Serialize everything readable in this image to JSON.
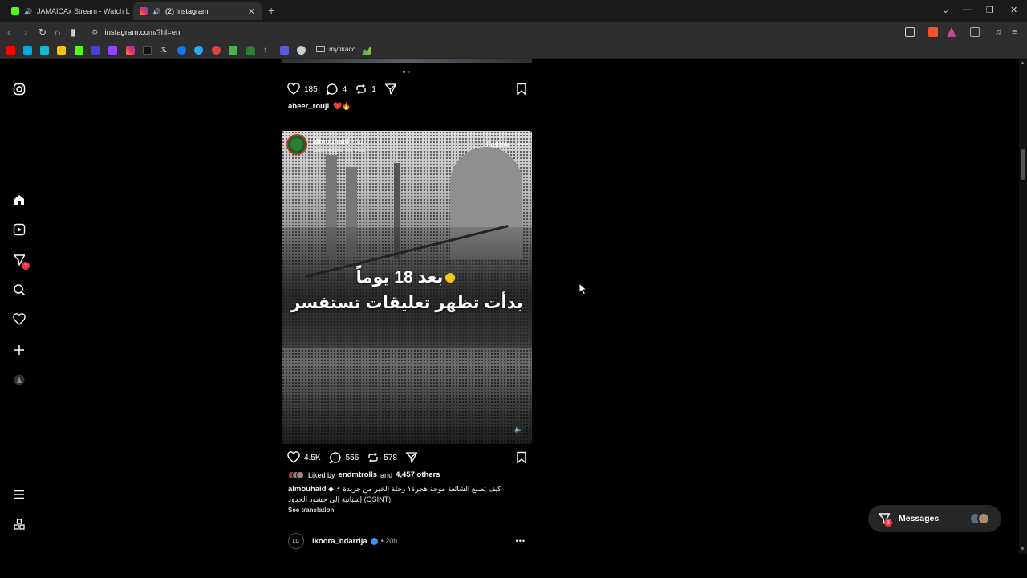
{
  "browser": {
    "tabs": [
      {
        "title": "JAMAICAx Stream - Watch Live o",
        "favicon_color": "#53fc18",
        "active": false
      },
      {
        "title": "(2) Instagram",
        "favicon_color": "#e1306c",
        "active": true
      }
    ],
    "new_tab": "+",
    "url": "instagram.com/?hl=en",
    "bookmark_folder": "mytikacc",
    "bookmark_icons": [
      "youtube",
      "prime-video",
      "perplexity",
      "kick",
      "nord",
      "twitch",
      "instagram",
      "tiktok",
      "x",
      "facebook",
      "telegram",
      "reddit-like",
      "game",
      "grok",
      "up-arrow",
      "tv",
      "chrome",
      "stats"
    ]
  },
  "sidebar": {
    "items": [
      "instagram-logo",
      "home",
      "reels",
      "messages",
      "search",
      "notifications",
      "create",
      "profile",
      "more",
      "meta"
    ],
    "messages_badge": "2"
  },
  "post1": {
    "likes": "185",
    "comments": "4",
    "reposts": "1",
    "caption_user": "abeer_rouji",
    "caption_emoji": "❤️🔥"
  },
  "post2": {
    "user": "almouhaid",
    "age": "• 1d",
    "subtitle": "Suggested for you",
    "follow_label": "Follow",
    "overlay_line1": "بعد 18 يوماً",
    "overlay_line2": "بدأت تظهر تعليقات تستفسر",
    "likes": "4.5K",
    "comments": "556",
    "reposts": "578",
    "liked_by_prefix": "Liked by",
    "liked_by_user": "endmtrolls",
    "liked_by_and": "and",
    "liked_by_others": "4,457 others",
    "caption_user": "almouhaid",
    "caption_text": "◆ ⚡ كيف تصنع الشائعة موجة هجرة؟ رحلة الخبر من جريدة إسبانية إلى حشود الحدود (OSINT).",
    "see_translation": "See translation"
  },
  "post3": {
    "user": "lkoora_bdarrija",
    "age": "• 20h",
    "avatar_text": "LC"
  },
  "messages_button": {
    "label": "Messages",
    "badge": "2"
  }
}
